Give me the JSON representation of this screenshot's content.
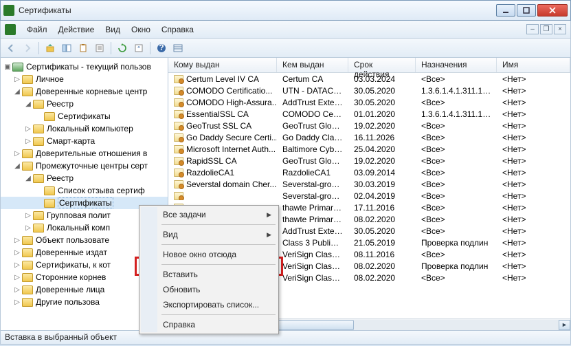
{
  "window": {
    "title": "Сертификаты"
  },
  "menu": {
    "file": "Файл",
    "action": "Действие",
    "view": "Вид",
    "window": "Окно",
    "help": "Справка"
  },
  "tree": {
    "root": "Сертификаты - текущий пользов",
    "personal": "Личное",
    "trusted_root": "Доверенные корневые центр",
    "registry": "Реестр",
    "certs": "Сертификаты",
    "local_computer": "Локальный компьютер",
    "smartcard": "Смарт-карта",
    "trust_rel": "Доверительные отношения в",
    "intermediate": "Промежуточные центры серт",
    "crl": "Список отзыва сертиф",
    "group_policy": "Групповая полит",
    "local_comp2": "Локальный комп",
    "user_object": "Объект пользовате",
    "trusted_pub": "Доверенные издат",
    "certs_to": "Сертификаты, к кот",
    "third_party": "Сторонние корнев",
    "trusted_people": "Доверенные лица",
    "other": "Другие пользова"
  },
  "columns": {
    "issued_to": "Кому выдан",
    "issued_by": "Кем выдан",
    "expires": "Срок действия",
    "purpose": "Назначения",
    "name": "Имя"
  },
  "rows": [
    {
      "to": "Certum Level IV CA",
      "by": "Certum CA",
      "exp": "03.03.2024",
      "pur": "<Все>",
      "name": "<Нет>"
    },
    {
      "to": "COMODO Certificatio...",
      "by": "UTN - DATACo...",
      "exp": "30.05.2020",
      "pur": "1.3.6.1.4.1.311.10.3...",
      "name": "<Нет>"
    },
    {
      "to": "COMODO High-Assura...",
      "by": "AddTrust Exter...",
      "exp": "30.05.2020",
      "pur": "<Все>",
      "name": "<Нет>"
    },
    {
      "to": "EssentialSSL CA",
      "by": "COMODO Certi...",
      "exp": "01.01.2020",
      "pur": "1.3.6.1.4.1.311.10.3...",
      "name": "<Нет>"
    },
    {
      "to": "GeoTrust SSL CA",
      "by": "GeoTrust Globa...",
      "exp": "19.02.2020",
      "pur": "<Все>",
      "name": "<Нет>"
    },
    {
      "to": "Go Daddy Secure Certi...",
      "by": "Go Daddy Class...",
      "exp": "16.11.2026",
      "pur": "<Все>",
      "name": "<Нет>"
    },
    {
      "to": "Microsoft Internet Auth...",
      "by": "Baltimore Cybe...",
      "exp": "25.04.2020",
      "pur": "<Все>",
      "name": "<Нет>"
    },
    {
      "to": "RapidSSL CA",
      "by": "GeoTrust Globa...",
      "exp": "19.02.2020",
      "pur": "<Все>",
      "name": "<Нет>"
    },
    {
      "to": "RazdolieCA1",
      "by": "RazdolieCA1",
      "exp": "03.09.2014",
      "pur": "<Все>",
      "name": "<Нет>"
    },
    {
      "to": "Severstal domain Cher...",
      "by": "Severstal-grou...",
      "exp": "30.03.2019",
      "pur": "<Все>",
      "name": "<Нет>"
    },
    {
      "to": "",
      "by": "Severstal-grou...",
      "exp": "02.04.2019",
      "pur": "<Все>",
      "name": "<Нет>"
    },
    {
      "to": "",
      "by": "thawte Primary...",
      "exp": "17.11.2016",
      "pur": "<Все>",
      "name": "<Нет>"
    },
    {
      "to": "",
      "by": "thawte Primary...",
      "exp": "08.02.2020",
      "pur": "<Все>",
      "name": "<Нет>"
    },
    {
      "to": "",
      "by": "AddTrust Exter...",
      "exp": "30.05.2020",
      "pur": "<Все>",
      "name": "<Нет>"
    },
    {
      "to": "",
      "by": "Class 3 Public P...",
      "exp": "21.05.2019",
      "pur": "Проверка подлин",
      "name": "<Нет>"
    },
    {
      "to": "",
      "by": "VeriSign Class 3...",
      "exp": "08.11.2016",
      "pur": "<Все>",
      "name": "<Нет>"
    },
    {
      "to": "",
      "by": "VeriSign Class 3...",
      "exp": "08.02.2020",
      "pur": "Проверка подлин",
      "name": "<Нет>"
    },
    {
      "to": "",
      "by": "VeriSign Class 3...",
      "exp": "08.02.2020",
      "pur": "<Все>",
      "name": "<Нет>"
    }
  ],
  "context_menu": {
    "all_tasks": "Все задачи",
    "view": "Вид",
    "new_window": "Новое окно отсюда",
    "paste": "Вставить",
    "refresh": "Обновить",
    "export_list": "Экспортировать список...",
    "help": "Справка"
  },
  "status": "Вставка в выбранный объект"
}
